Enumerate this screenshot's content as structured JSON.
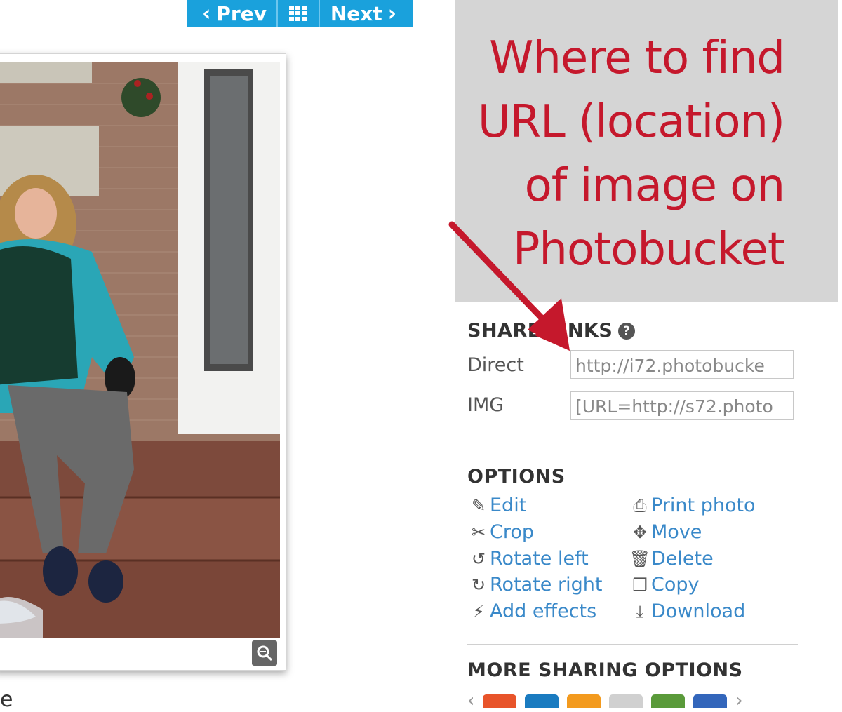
{
  "nav": {
    "prev_label": "Prev",
    "next_label": "Next"
  },
  "annotation": {
    "lines": [
      "Where to find",
      "URL (location)",
      "of image on",
      "Photobucket"
    ],
    "color": "#c5182c"
  },
  "share_links": {
    "title": "SHARE LINKS",
    "help": "?",
    "rows": [
      {
        "label": "Direct",
        "value": "http://i72.photobucke"
      },
      {
        "label": "IMG",
        "value": "[URL=http://s72.photo"
      }
    ]
  },
  "options": {
    "title": "OPTIONS",
    "left": [
      {
        "label": "Edit",
        "icon": "edit-icon"
      },
      {
        "label": "Crop",
        "icon": "crop-icon"
      },
      {
        "label": "Rotate left",
        "icon": "rotate-left-icon"
      },
      {
        "label": "Rotate right",
        "icon": "rotate-right-icon"
      },
      {
        "label": "Add effects",
        "icon": "magic-wand-icon"
      }
    ],
    "right": [
      {
        "label": "Print photo",
        "icon": "print-icon"
      },
      {
        "label": "Move",
        "icon": "move-icon"
      },
      {
        "label": "Delete",
        "icon": "trash-icon"
      },
      {
        "label": "Copy",
        "icon": "copy-icon"
      },
      {
        "label": "Download",
        "icon": "download-icon"
      }
    ]
  },
  "more_sharing": {
    "title": "MORE SHARING OPTIONS",
    "services": [
      {
        "icon": "stumbleupon-icon",
        "color": "#e8542a"
      },
      {
        "icon": "linkedin-icon",
        "color": "#1a7bc0"
      },
      {
        "icon": "blogger-icon",
        "color": "#f39a1e"
      },
      {
        "icon": "reddit-icon",
        "color": "#d0d0d0"
      },
      {
        "icon": "myspace-icon",
        "color": "#5a9a3a"
      },
      {
        "icon": "delicious-icon",
        "color": "#3366bb"
      }
    ]
  },
  "caption_fragment": "e",
  "accent": "#1aa1dc",
  "link_color": "#3a89c9"
}
